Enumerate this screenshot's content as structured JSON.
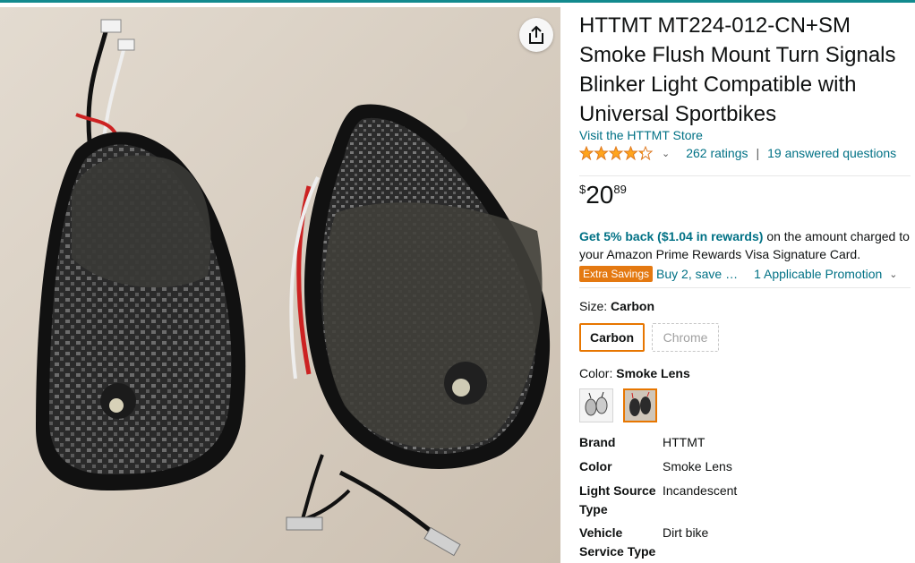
{
  "product": {
    "title": "HTTMT MT224-012-CN+SM Smoke Flush Mount Turn Signals Blinker Light Compatible with Universal Sportbikes",
    "store_link": "Visit the HTTMT Store",
    "rating": 4.2,
    "ratings_count": "262 ratings",
    "answered": "19 answered questions",
    "price": {
      "symbol": "$",
      "whole": "20",
      "fraction": "89"
    },
    "reward": {
      "link_text": "Get 5% back ($1.04 in rewards)",
      "rest_text": " on the amount charged to your Amazon Prime Rewards Visa Signature Card."
    },
    "promo": {
      "badge": "Extra Savings",
      "buy_text": "Buy 2, save …",
      "promotion": "1 Applicable Promotion"
    },
    "size": {
      "label": "Size:",
      "selected": "Carbon",
      "options": [
        "Carbon",
        "Chrome"
      ]
    },
    "color": {
      "label": "Color:",
      "selected": "Smoke Lens"
    },
    "specs": [
      {
        "key": "Brand",
        "value": "HTTMT"
      },
      {
        "key": "Color",
        "value": "Smoke Lens"
      },
      {
        "key": "Light Source Type",
        "value": "Incandescent"
      },
      {
        "key": "Vehicle Service Type",
        "value": "Dirt bike"
      }
    ]
  },
  "colors": {
    "accent": "#e77600",
    "link": "#007185",
    "star": "#ffa41c",
    "badge": "#e47911"
  },
  "icons": {
    "share": "share-icon",
    "star": "star-icon",
    "chevron": "chevron-down-icon"
  }
}
